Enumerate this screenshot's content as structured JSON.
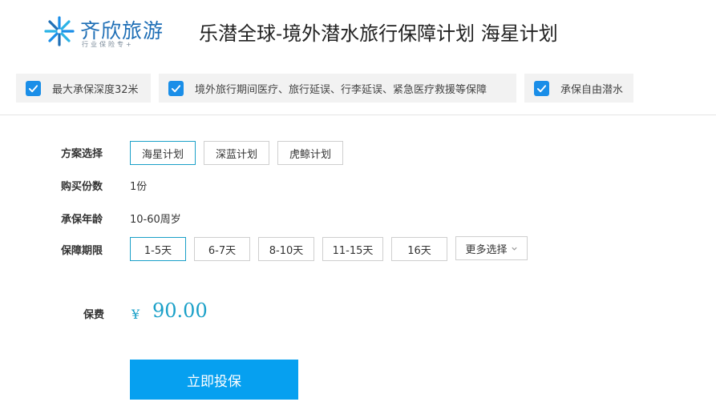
{
  "brand": {
    "name": "齐欣旅游",
    "tagline": "行业保险专+"
  },
  "page_title": "乐潜全球-境外潜水旅行保障计划  海星计划",
  "features": [
    {
      "label": "最大承保深度32米",
      "checked": true
    },
    {
      "label": "境外旅行期间医疗、旅行延误、行李延误、紧急医疗救援等保障",
      "checked": true
    },
    {
      "label": "承保自由潜水",
      "checked": true
    }
  ],
  "plan": {
    "label": "方案选择",
    "options": [
      "海星计划",
      "深蓝计划",
      "虎鲸计划"
    ],
    "selected": "海星计划"
  },
  "quantity": {
    "label": "购买份数",
    "value": "1份"
  },
  "age": {
    "label": "承保年龄",
    "value": "10-60周岁"
  },
  "period": {
    "label": "保障期限",
    "options": [
      "1-5天",
      "6-7天",
      "8-10天",
      "11-15天",
      "16天"
    ],
    "selected": "1-5天",
    "more_label": "更多选择"
  },
  "premium": {
    "label": "保费",
    "currency": "¥",
    "amount": "90.00"
  },
  "buy_button": "立即投保",
  "colors": {
    "accent": "#1aa0c8",
    "button": "#06a0f0",
    "checkbox": "#1a8ee8",
    "brand": "#1f6fb6"
  }
}
